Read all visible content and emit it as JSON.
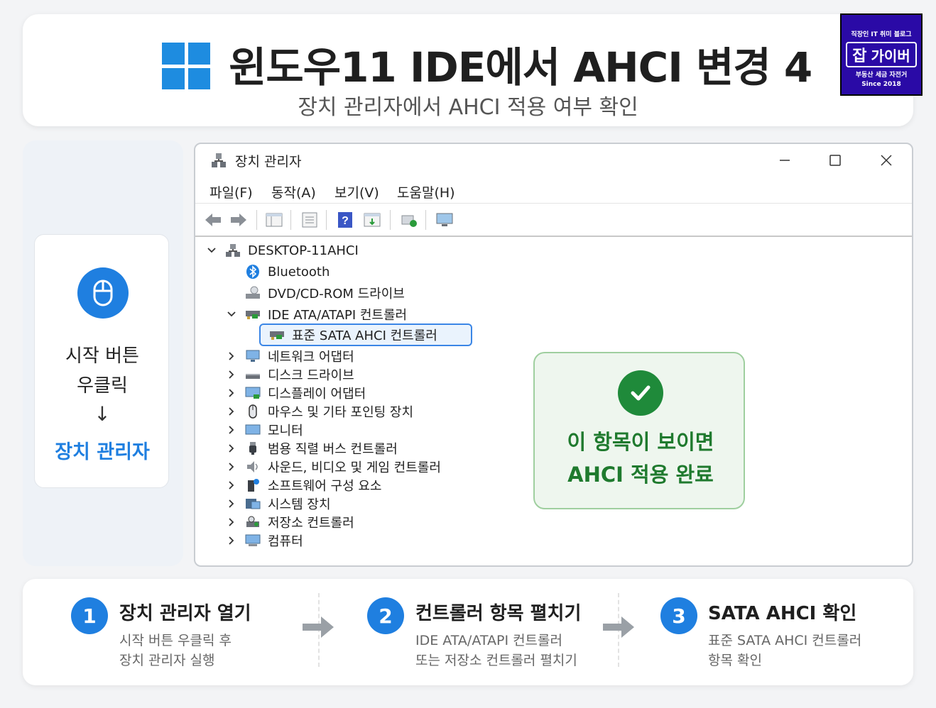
{
  "header": {
    "title": "윈도우11 IDE에서 AHCI 변경 4",
    "subtitle": "장치 관리자에서 AHCI 적용 여부 확인"
  },
  "badge": {
    "top": "직장인 IT 취미 블로그",
    "brand_char": "잡",
    "brand_name": "가이버",
    "sub": "부동산 세금 자전거",
    "since": "Since 2018"
  },
  "left": {
    "line1": "시작 버튼",
    "line2": "우클릭",
    "arrow": "↓",
    "target": "장치 관리자"
  },
  "window": {
    "title": "장치 관리자",
    "menu": [
      "파일(F)",
      "동작(A)",
      "보기(V)",
      "도움말(H)"
    ],
    "tree": {
      "root": "DESKTOP-11AHCI",
      "bluetooth": "Bluetooth",
      "dvd": "DVD/CD-ROM 드라이브",
      "ide": "IDE ATA/ATAPI 컨트롤러",
      "sata": "표준 SATA AHCI 컨트롤러",
      "network": "네트워크 어댑터",
      "disk": "디스크 드라이브",
      "display": "디스플레이 어댑터",
      "mouse": "마우스 및 기타 포인팅 장치",
      "monitor": "모니터",
      "usb": "범용 직렬 버스 컨트롤러",
      "sound": "사운드, 비디오 및 게임 컨트롤러",
      "software": "소프트웨어 구성 요소",
      "system": "시스템 장치",
      "storage": "저장소 컨트롤러",
      "computer": "컴퓨터"
    }
  },
  "callout": {
    "line1": "이 항목이 보이면",
    "line2": "AHCI 적용 완료"
  },
  "steps": [
    {
      "num": "1",
      "title": "장치 관리자 열기",
      "desc1": "시작 버튼 우클릭 후",
      "desc2": "장치 관리자 실행"
    },
    {
      "num": "2",
      "title": "컨트롤러 항목 펼치기",
      "desc1": "IDE ATA/ATAPI 컨트롤러",
      "desc2": "또는 저장소 컨트롤러 펼치기"
    },
    {
      "num": "3",
      "title": "SATA AHCI 확인",
      "desc1": "표준 SATA AHCI 컨트롤러",
      "desc2": "항목 확인"
    }
  ],
  "colors": {
    "accent": "#1f7fe0",
    "success": "#1f8a3a",
    "badge_bg": "#2a0aa6"
  }
}
